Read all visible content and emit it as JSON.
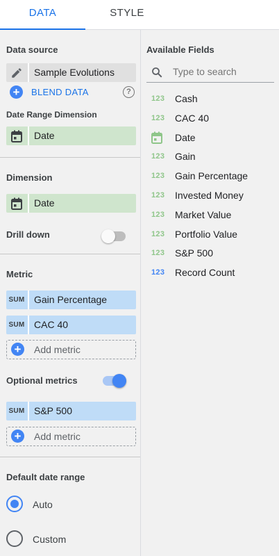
{
  "tabs": [
    {
      "label": "DATA"
    },
    {
      "label": "STYLE"
    }
  ],
  "data_source": {
    "title": "Data source",
    "name": "Sample Evolutions",
    "blend_label": "BLEND DATA",
    "help_icon": "help-icon"
  },
  "date_range_dimension": {
    "title": "Date Range Dimension",
    "field": "Date"
  },
  "dimension": {
    "title": "Dimension",
    "field": "Date",
    "drill_down_label": "Drill down",
    "drill_down_on": false
  },
  "metric": {
    "title": "Metric",
    "items": [
      {
        "agg": "SUM",
        "field": "Gain Percentage"
      },
      {
        "agg": "SUM",
        "field": "CAC 40"
      }
    ],
    "add_label": "Add metric"
  },
  "optional_metrics": {
    "title": "Optional metrics",
    "enabled": true,
    "items": [
      {
        "agg": "SUM",
        "field": "S&P 500"
      }
    ],
    "add_label": "Add metric"
  },
  "default_date_range": {
    "title": "Default date range",
    "options": [
      {
        "label": "Auto",
        "selected": true
      },
      {
        "label": "Custom",
        "selected": false
      }
    ]
  },
  "available_fields": {
    "title": "Available Fields",
    "search_placeholder": "Type to search",
    "fields": [
      {
        "icon": "123",
        "type": "metric",
        "name": "Cash"
      },
      {
        "icon": "123",
        "type": "metric",
        "name": "CAC 40"
      },
      {
        "icon": "calendar-icon",
        "type": "date",
        "name": "Date"
      },
      {
        "icon": "123",
        "type": "metric",
        "name": "Gain"
      },
      {
        "icon": "123",
        "type": "metric",
        "name": "Gain Percentage"
      },
      {
        "icon": "123",
        "type": "metric",
        "name": "Invested Money"
      },
      {
        "icon": "123",
        "type": "metric",
        "name": "Market Value"
      },
      {
        "icon": "123",
        "type": "metric",
        "name": "Portfolio Value"
      },
      {
        "icon": "123",
        "type": "metric",
        "name": "S&P 500"
      },
      {
        "icon": "123",
        "type": "calculated",
        "name": "Record Count"
      }
    ]
  },
  "colors": {
    "accent": "#1a73e8",
    "dimension_chip": "#cfe5cd",
    "metric_chip": "#bfdcf7",
    "field_metric_icon": "#8fc68a",
    "field_count_icon": "#4285f4"
  }
}
